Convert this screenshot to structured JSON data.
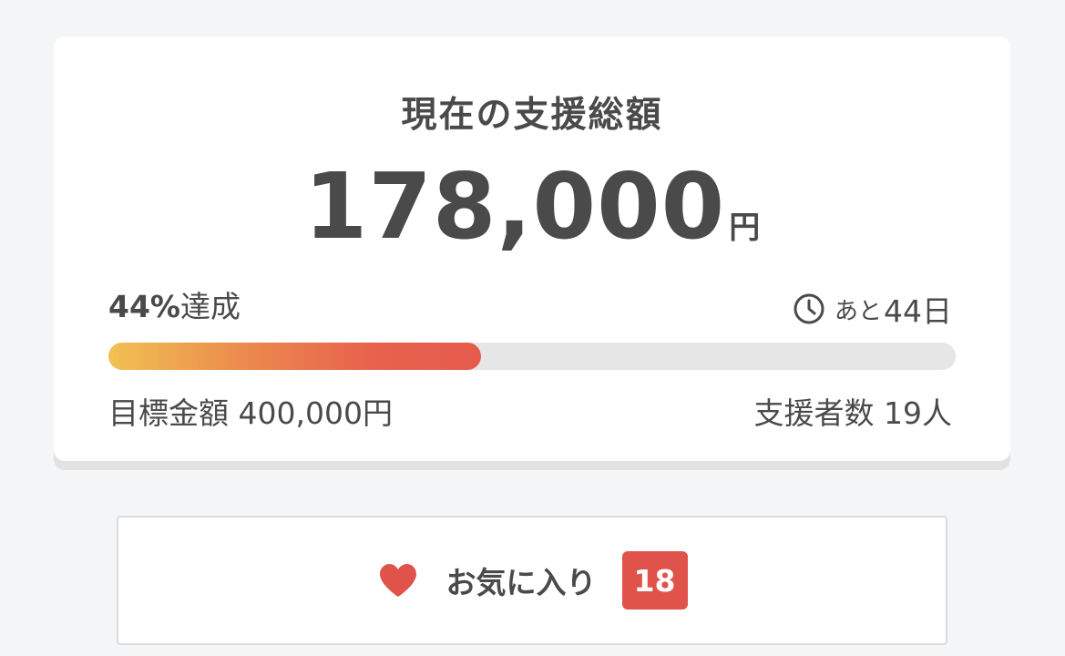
{
  "summary": {
    "title": "現在の支援総額",
    "total_amount": "178,000",
    "total_unit": "円",
    "achieved_percent": "44%",
    "achieved_suffix": "達成",
    "progress": 0.44,
    "remaining_prefix": "あと",
    "remaining_days": "44日",
    "goal_text": "目標金額 400,000円",
    "backers_text": "支援者数 19人"
  },
  "favorite": {
    "label": "お気に入り",
    "count": "18"
  },
  "icons": {
    "clock": "clock-icon",
    "heart": "heart-icon"
  },
  "colors": {
    "accent_red": "#e0534a",
    "progress_start": "#f1c152",
    "progress_end": "#e55b4d",
    "text": "#4a4a4a",
    "track": "#e6e6e6"
  }
}
